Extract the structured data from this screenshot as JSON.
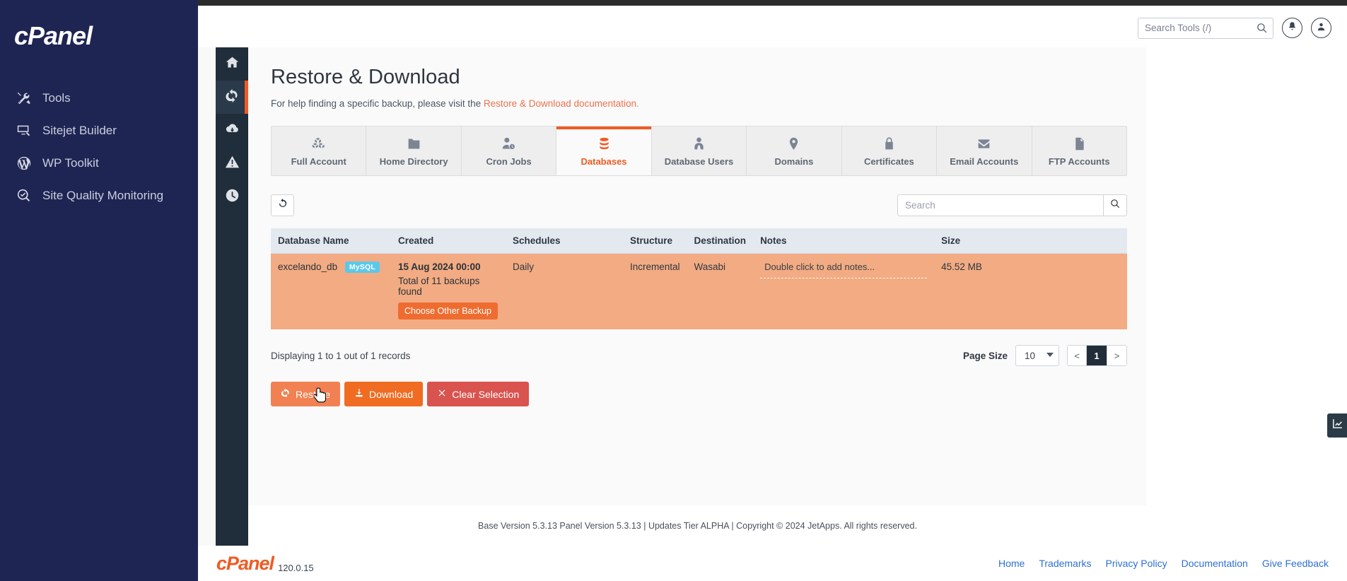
{
  "brand": {
    "logo": "cPanel"
  },
  "sidebar": {
    "items": [
      {
        "label": "Tools",
        "icon": "tools-icon"
      },
      {
        "label": "Sitejet Builder",
        "icon": "monitor-pen-icon"
      },
      {
        "label": "WP Toolkit",
        "icon": "wordpress-icon"
      },
      {
        "label": "Site Quality Monitoring",
        "icon": "magnifier-check-icon"
      }
    ]
  },
  "header": {
    "search_placeholder": "Search Tools (/)",
    "search_value": "",
    "notifications_icon": "bell-icon",
    "account_icon": "user-icon"
  },
  "icon_rail": {
    "items": [
      {
        "icon": "home-icon",
        "active": false
      },
      {
        "icon": "restore-refresh-icon",
        "active": true
      },
      {
        "icon": "cloud-download-icon",
        "active": false
      },
      {
        "icon": "warning-icon",
        "active": false
      },
      {
        "icon": "clock-icon",
        "active": false
      }
    ]
  },
  "main": {
    "title": "Restore & Download",
    "subtitle_prefix": "For help finding a specific backup, please visit the ",
    "subtitle_link": "Restore & Download documentation.",
    "tabs": [
      {
        "label": "Full Account",
        "icon": "boxes-icon",
        "active": false
      },
      {
        "label": "Home Directory",
        "icon": "folder-icon",
        "active": false
      },
      {
        "label": "Cron Jobs",
        "icon": "user-clock-icon",
        "active": false
      },
      {
        "label": "Databases",
        "icon": "database-icon",
        "active": true
      },
      {
        "label": "Database Users",
        "icon": "user-tie-icon",
        "active": false
      },
      {
        "label": "Domains",
        "icon": "map-pin-icon",
        "active": false
      },
      {
        "label": "Certificates",
        "icon": "lock-icon",
        "active": false
      },
      {
        "label": "Email Accounts",
        "icon": "envelope-icon",
        "active": false
      },
      {
        "label": "FTP Accounts",
        "icon": "file-icon",
        "active": false
      }
    ],
    "toolbar": {
      "refresh_icon": "refresh-icon",
      "search_placeholder": "Search",
      "search_value": "",
      "search_button_icon": "search-icon"
    },
    "table": {
      "columns": [
        "Database Name",
        "Created",
        "Schedules",
        "Structure",
        "Destination",
        "Notes",
        "Size"
      ],
      "rows": [
        {
          "database_name": "excelando_db",
          "badge": "MySQL",
          "created_date": "15 Aug 2024 00:00",
          "created_total": "Total of 11 backups found",
          "choose_button": "Choose Other Backup",
          "schedules": "Daily",
          "structure": "Incremental",
          "destination": "Wasabi",
          "notes_placeholder": "Double click to add notes...",
          "size": "45.52 MB",
          "selected": true
        }
      ]
    },
    "records_text": "Displaying 1 to 1 out of 1 records",
    "pagination": {
      "page_size_label": "Page Size",
      "page_size_value": "10",
      "prev": "<",
      "current_page": "1",
      "next": ">"
    },
    "actions": [
      {
        "label": "Restore",
        "icon": "refresh-icon",
        "style": "restore"
      },
      {
        "label": "Download",
        "icon": "download-icon",
        "style": "download"
      },
      {
        "label": "Clear Selection",
        "icon": "x-icon",
        "style": "clear"
      }
    ]
  },
  "panel_footer": {
    "text": "Base Version 5.3.13 Panel Version 5.3.13 | Updates Tier ALPHA | Copyright © 2024 JetApps. All rights reserved."
  },
  "page_footer": {
    "logo": "cPanel",
    "version": "120.0.15",
    "links": [
      "Home",
      "Trademarks",
      "Privacy Policy",
      "Documentation",
      "Give Feedback"
    ]
  },
  "analytics_tab": {
    "icon": "chart-icon"
  },
  "colors": {
    "accent_orange": "#f15a22",
    "navy": "#1f2553",
    "rail_dark": "#202d3a",
    "row_selected": "#f2ab82",
    "badge_blue": "#5bc8ea",
    "danger_red": "#d9534f",
    "link_blue": "#2f6fd4"
  }
}
